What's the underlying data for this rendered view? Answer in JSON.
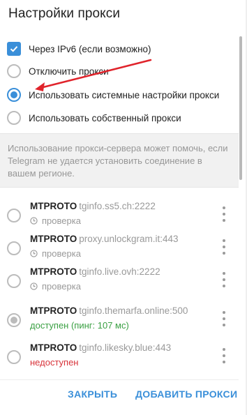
{
  "dialog": {
    "title": "Настройки прокси"
  },
  "options": [
    {
      "label": "Через IPv6 (если возможно)",
      "state": "checked"
    },
    {
      "label": "Отключить прокси",
      "state": "off"
    },
    {
      "label": "Использовать системные настройки прокси",
      "state": "on"
    },
    {
      "label": "Использовать собственный прокси",
      "state": "off"
    }
  ],
  "info_text": "Использование прокси-сервера может помочь, если Telegram не удается установить соединение в вашем регионе.",
  "proxies": [
    {
      "type": "MTPROTO",
      "host": "tginfo.ss5.ch:2222",
      "status": "проверка",
      "state": "checking"
    },
    {
      "type": "MTPROTO",
      "host": "proxy.unlockgram.it:443",
      "status": "проверка",
      "state": "checking"
    },
    {
      "type": "MTPROTO",
      "host": "tginfo.live.ovh:2222",
      "status": "проверка",
      "state": "checking"
    },
    {
      "type": "MTPROTO",
      "host": "tginfo.themarfa.online:500",
      "status": "доступен (пинг: 107 мс)",
      "state": "ok"
    },
    {
      "type": "MTPROTO",
      "host": "tginfo.likesky.blue:443",
      "status": "недоступен",
      "state": "bad"
    }
  ],
  "buttons": {
    "close": "ЗАКРЫТЬ",
    "add": "ДОБАВИТЬ ПРОКСИ"
  },
  "colors": {
    "accent": "#3a8fd9",
    "ok": "#3aa043",
    "bad": "#d8333a",
    "annotation_arrow": "#e0232b"
  },
  "icons": {
    "check": "check-icon",
    "clock": "clock-icon",
    "menu": "more-vertical-icon"
  }
}
